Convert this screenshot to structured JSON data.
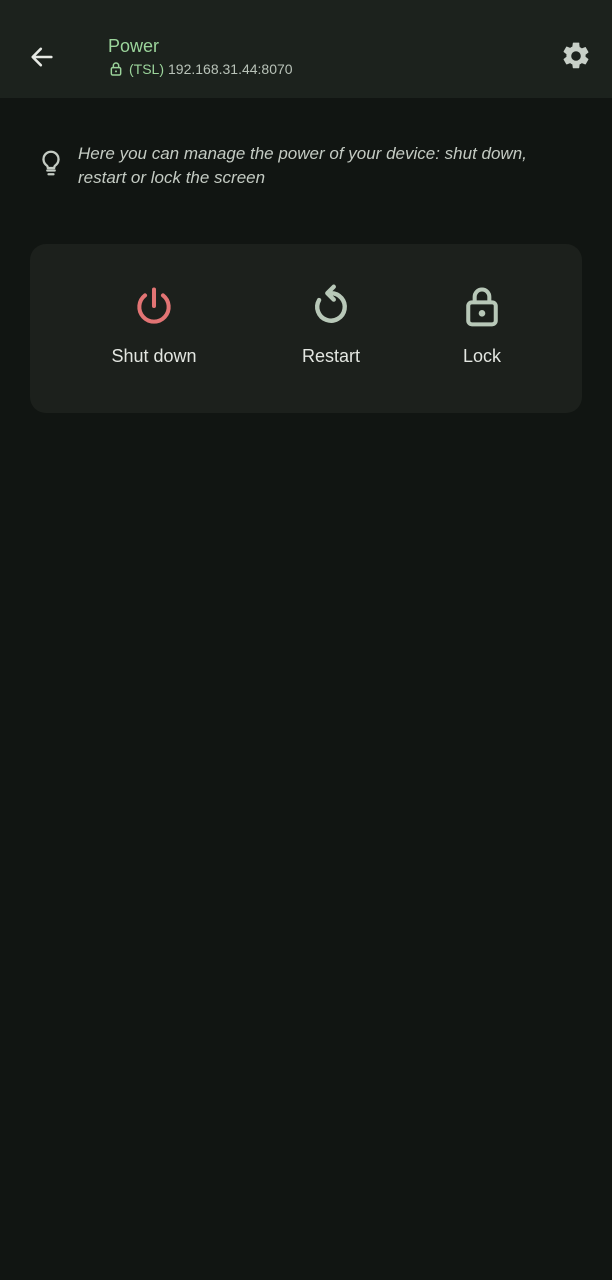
{
  "header": {
    "title": "Power",
    "connection_protocol": "(TSL)",
    "connection_address": "192.168.31.44:8070",
    "back_icon": "arrow-left-icon",
    "settings_icon": "gear-icon"
  },
  "hint": {
    "icon": "lightbulb-icon",
    "text": "Here you can manage the power of your device: shut down, restart or lock the screen"
  },
  "actions": [
    {
      "label": "Shut down",
      "icon": "power-icon",
      "color": "#e27474"
    },
    {
      "label": "Restart",
      "icon": "restart-icon",
      "color": "#b8c8b8"
    },
    {
      "label": "Lock",
      "icon": "lock-icon",
      "color": "#b8c8b8"
    }
  ],
  "colors": {
    "accent": "#9bd49b",
    "background": "#111512",
    "app_bar": "#1c221d",
    "card": "#1c201c"
  }
}
